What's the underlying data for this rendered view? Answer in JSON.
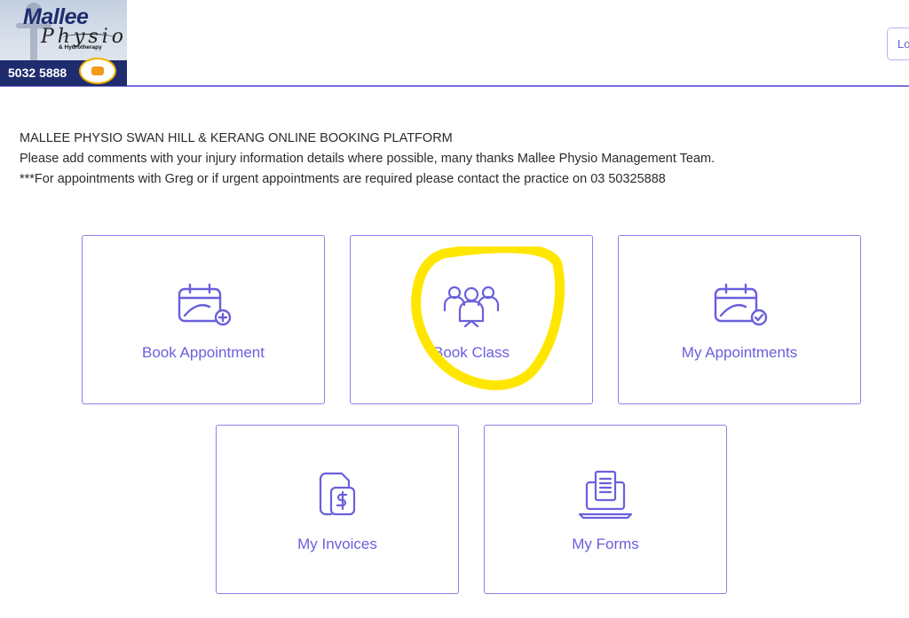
{
  "header": {
    "logo": {
      "line1": "Mallee",
      "line2": "Physio",
      "line3": "& Hydrotherapy",
      "phone": "5032 5888"
    },
    "login_label": "Lo"
  },
  "intro": {
    "line1": "MALLEE PHYSIO SWAN HILL & KERANG ONLINE BOOKING PLATFORM",
    "line2": "Please add comments with your injury information details where possible, many thanks Mallee Physio Management Team.",
    "line3": "***For appointments with Greg or if urgent appointments are required please contact the practice on 03 50325888"
  },
  "tiles": [
    {
      "label": "Book Appointment",
      "icon": "calendar-plus-icon"
    },
    {
      "label": "Book Class",
      "icon": "group-icon"
    },
    {
      "label": "My Appointments",
      "icon": "calendar-check-icon"
    },
    {
      "label": "My Invoices",
      "icon": "invoice-dollar-icon"
    },
    {
      "label": "My Forms",
      "icon": "laptop-form-icon"
    }
  ],
  "colors": {
    "accent": "#6a5fdd",
    "tile_border": "#8b83e8",
    "header_line": "#7b72de",
    "highlight": "#ffe600"
  }
}
